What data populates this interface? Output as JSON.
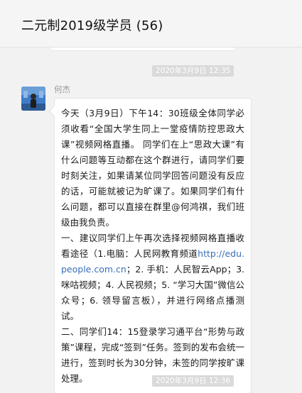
{
  "window": {
    "title": "二元制2019级学员 (56)"
  },
  "messages": [
    {
      "timestamp": "2020年3月9日 12:35",
      "sender": "何杰",
      "paragraphs": [
        "今天（3月9日）下午14：30班级全体同学必须收看“全国大学生同上一堂疫情防控思政大课”视频网格直播。 同学们在上“思政大课”有什么问题等互动都在这个群进行，请同学们要时刻关注，如果请某位同学回答问题没有反应的话，可能就被记为旷课了。如果同学们有什么问题，都可以直接在群里@何鸿祺，我们班级由我负责。",
        "一、建议同学们上午再次选择视频网格直播收看途径（1.电脑：人民网教育频道",
        "；2. 手机：人民智云App；3. 咪咕视频；4. 人民视频；5. “学习大国”微信公众号；6. 领导留言板），并进行网络点播测试。",
        "二、同学们14：15登录学习通平台“形势与政策”课程，完成“签到”任务。签到的发布会统一进行，签到时长为30分钟，未签的同学按旷课处理。"
      ],
      "link": "http://edu.people.com.cn"
    },
    {
      "timestamp": "2020年3月9日 12:36"
    }
  ],
  "colors": {
    "link": "#3a6fb7",
    "chip": "#dadada",
    "bubble": "#ffffff"
  }
}
